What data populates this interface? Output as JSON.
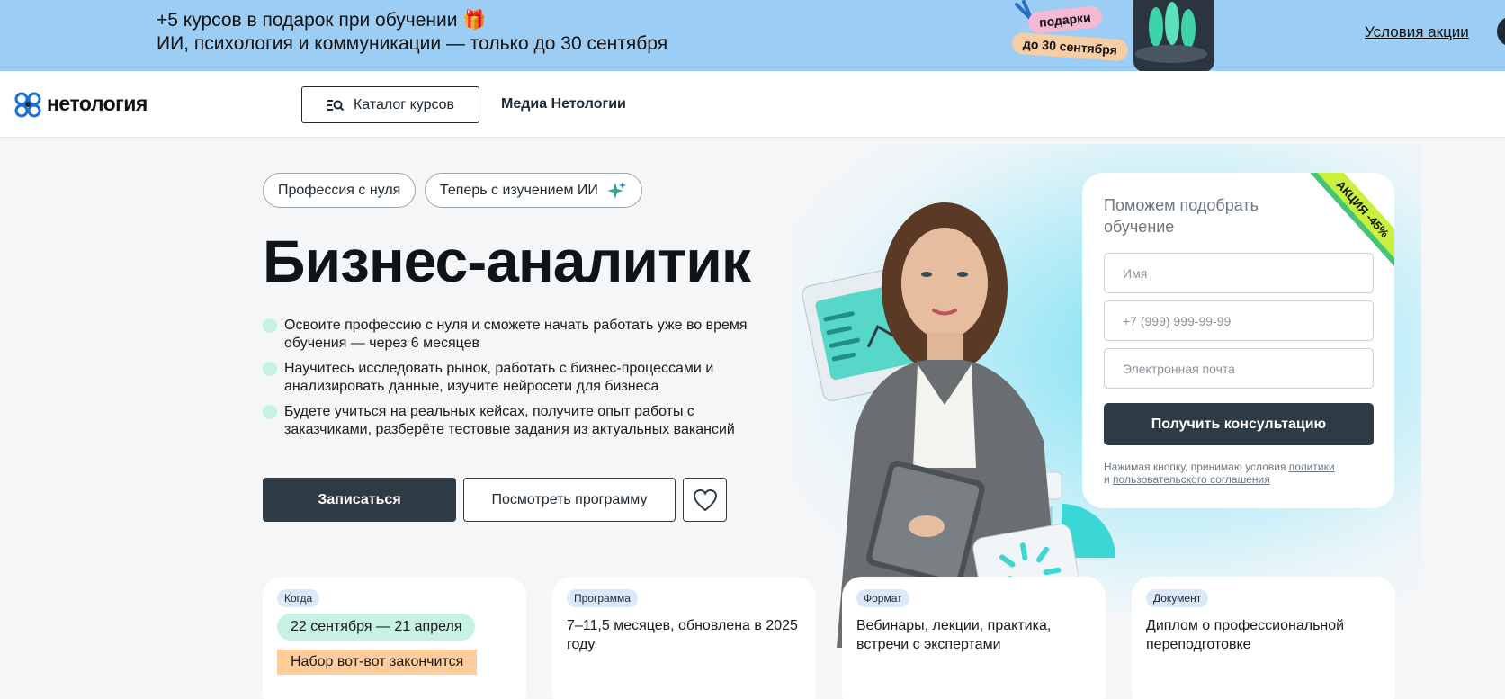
{
  "promo": {
    "line1": "+5 курсов в подарок при обучении 🎁",
    "line2": "ИИ, психология и коммуникации — только до 30 сентября",
    "tag_gifts": "подарки",
    "tag_date": "до 30 сентября",
    "link": "Условия акции"
  },
  "header": {
    "logo_text": "нетология",
    "catalog_label": "Каталог курсов",
    "media_label": "Медиа Нетологии"
  },
  "hero": {
    "chips": [
      "Профессия с нуля",
      "Теперь с изучением ИИ"
    ],
    "title": "Бизнес-аналитик",
    "bullets": [
      "Освоите профессию с нуля и сможете начать работать уже во время обучения — через 6 месяцев",
      "Научитесь исследовать рынок, работать с бизнес-процессами и анализировать данные, изучите нейросети для бизнеса",
      "Будете учиться на реальных кейсах, получите опыт работы с заказчиками, разберёте тестовые задания из актуальных вакансий"
    ],
    "enroll_label": "Записаться",
    "program_label": "Посмотреть программу"
  },
  "form": {
    "title": "Поможем подобрать обучение",
    "ribbon": "АКЦИЯ -45%",
    "name_placeholder": "Имя",
    "phone_placeholder": "+7 (999) 999-99-99",
    "email_placeholder": "Электронная почта",
    "submit_label": "Получить консультацию",
    "note_prefix": "Нажимая кнопку, принимаю условия",
    "note_policy": "политики",
    "note_and": "и",
    "note_agreement": "пользовательского соглашения"
  },
  "info": {
    "when_label": "Когда",
    "when_value": "22 сентября — 21 апреля",
    "when_urgency": "Набор вот-вот закончится",
    "program_label": "Программа",
    "program_value": "7–11,5 месяцев, обновлена в 2025 году",
    "format_label": "Формат",
    "format_value": "Вебинары, лекции, практика, встречи с экспертами",
    "document_label": "Документ",
    "document_value": "Диплом о профессиональной переподготовке"
  },
  "colors": {
    "promo_bg": "#9ccef5",
    "primary": "#2e3a44",
    "mint": "#c7f2e3",
    "peach": "#ffcc9c",
    "ribbon": "#c9f03c"
  },
  "icons": [
    "gift-icon",
    "search-list-icon",
    "sparkle-icon",
    "heart-icon"
  ]
}
